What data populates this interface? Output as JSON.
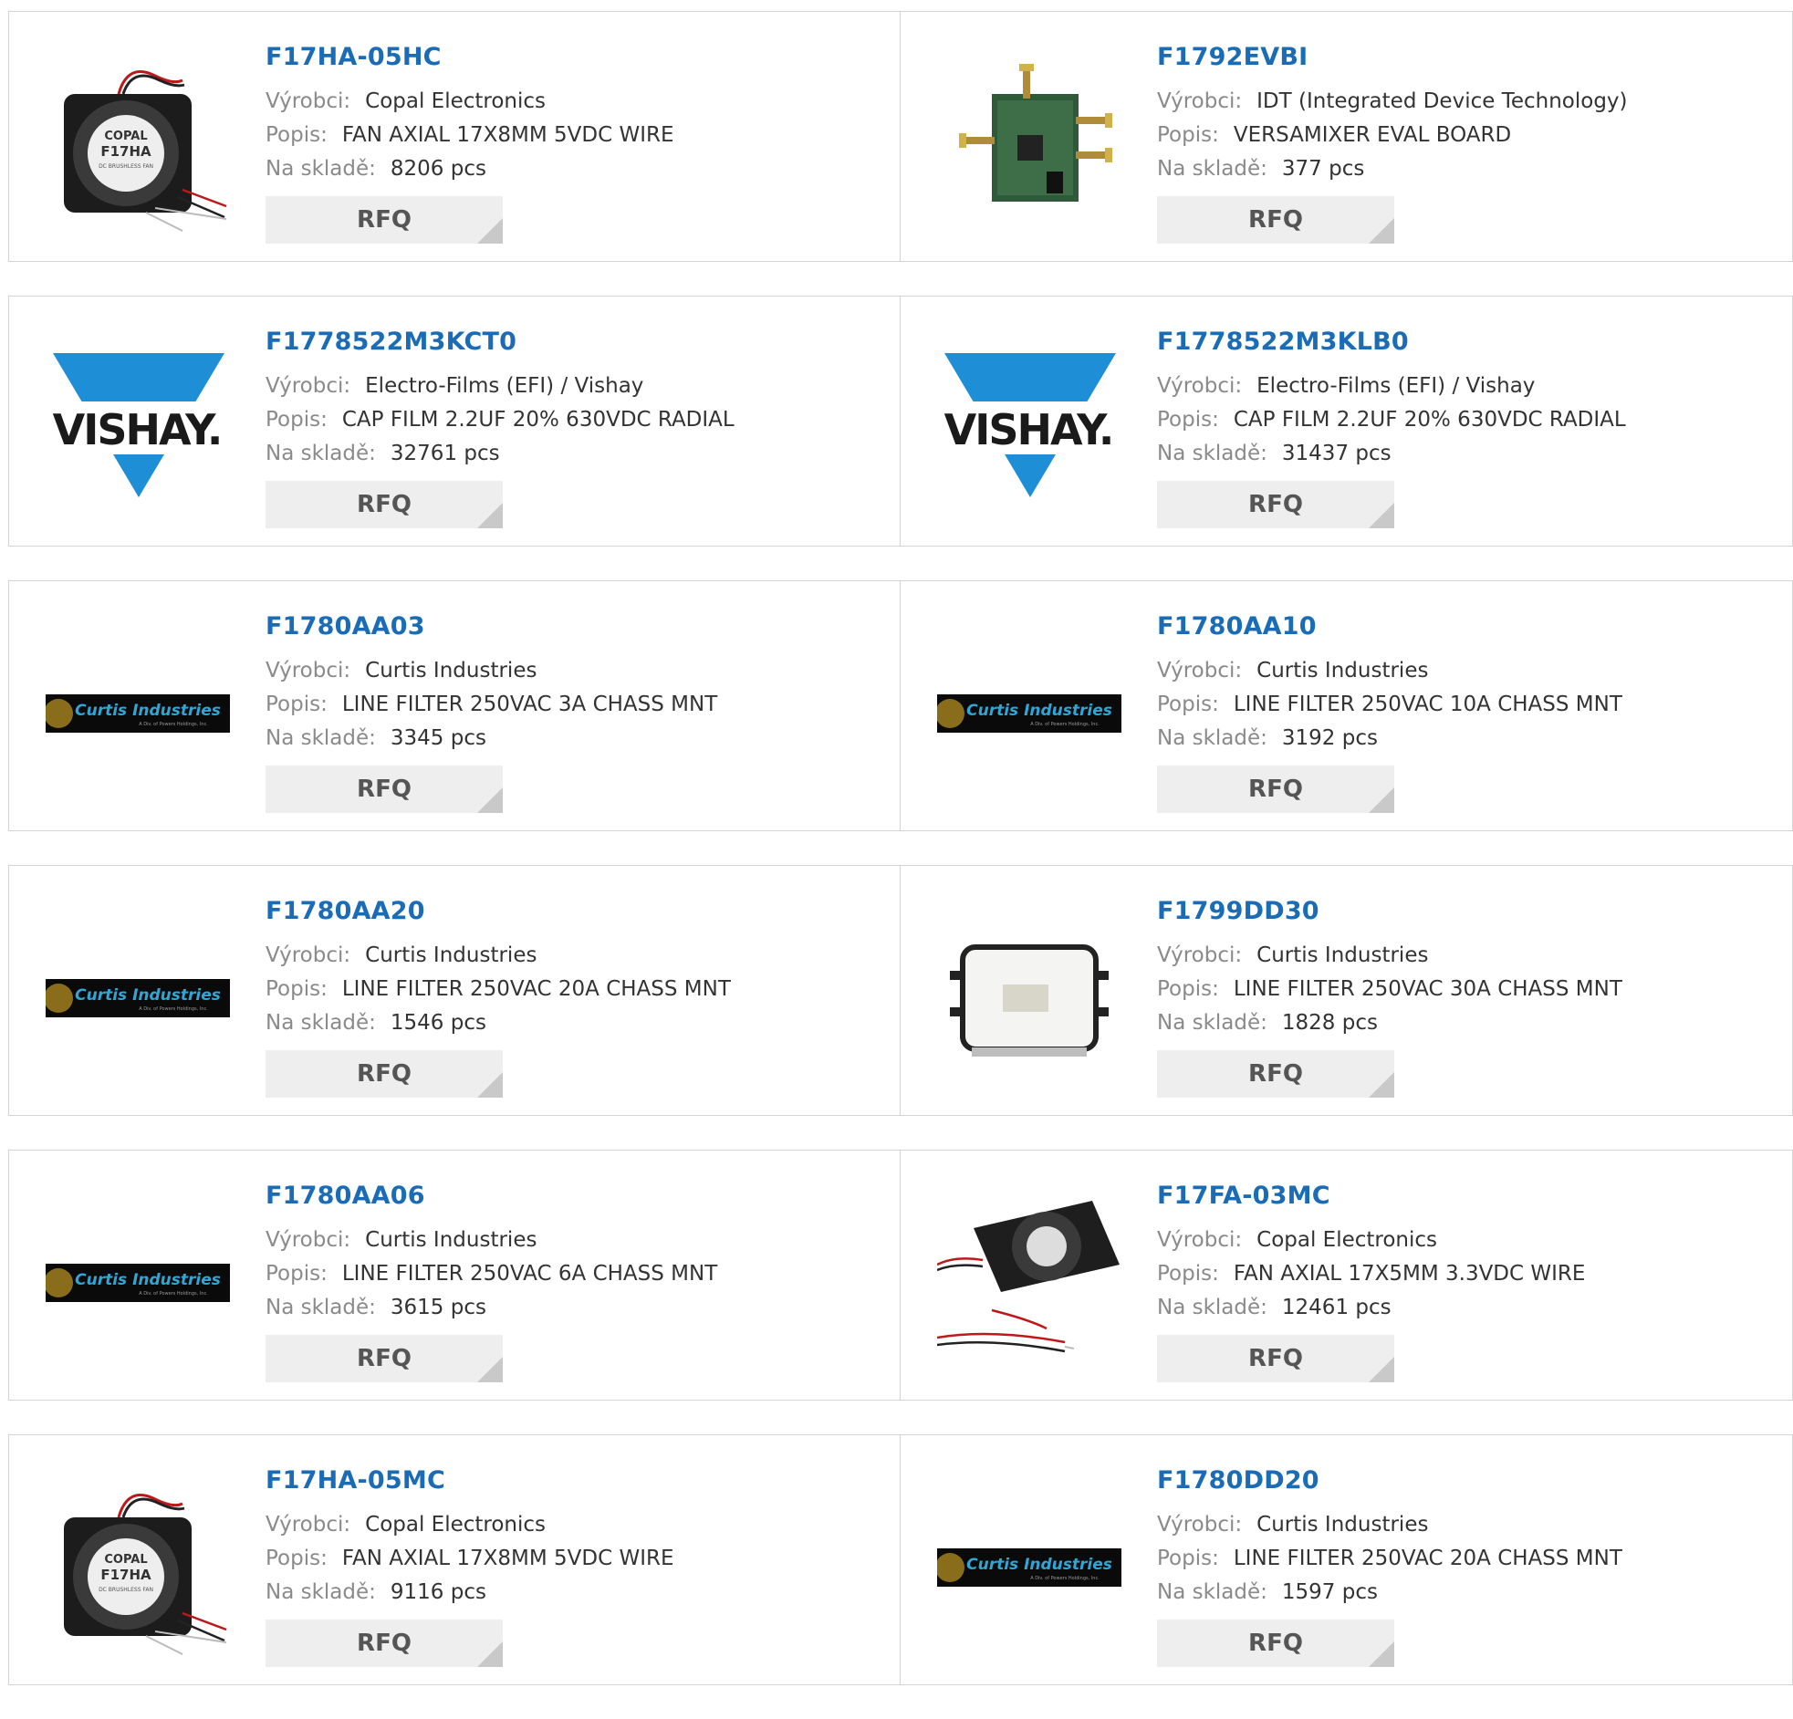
{
  "labels": {
    "manufacturer": "Výrobci:",
    "description": "Popis:",
    "stock": "Na skladě:",
    "rfq": "RFQ"
  },
  "colors": {
    "title_link": "#1a6cb6",
    "label_gray": "#8a8a8a",
    "rfq_bg": "#eeeeee",
    "vishay_blue": "#1e8fd6",
    "border": "#d3d3d3"
  },
  "products": [
    {
      "part": "F17HA-05HC",
      "manufacturer": "Copal Electronics",
      "description": "FAN AXIAL 17X8MM 5VDC WIRE",
      "stock": "8206 pcs",
      "image": "copal-fan-17ha",
      "fan_text": [
        "COPAL",
        "F17HA",
        "DC BRUSHLESS FAN"
      ]
    },
    {
      "part": "F1792EVBI",
      "manufacturer": "IDT (Integrated Device Technology)",
      "description": "VERSAMIXER EVAL BOARD",
      "stock": "377 pcs",
      "image": "eval-board"
    },
    {
      "part": "F1778522M3KCT0",
      "manufacturer": "Electro-Films (EFI) / Vishay",
      "description": "CAP FILM 2.2UF 20% 630VDC RADIAL",
      "stock": "32761 pcs",
      "image": "vishay-logo",
      "logo_text": "VISHAY."
    },
    {
      "part": "F1778522M3KLB0",
      "manufacturer": "Electro-Films (EFI) / Vishay",
      "description": "CAP FILM 2.2UF 20% 630VDC RADIAL",
      "stock": "31437 pcs",
      "image": "vishay-logo",
      "logo_text": "VISHAY."
    },
    {
      "part": "F1780AA03",
      "manufacturer": "Curtis Industries",
      "description": "LINE FILTER 250VAC 3A CHASS MNT",
      "stock": "3345 pcs",
      "image": "curtis-logo",
      "logo_text": "Curtis Industries",
      "logo_sub": "A Div. of Powers Holdings, Inc."
    },
    {
      "part": "F1780AA10",
      "manufacturer": "Curtis Industries",
      "description": "LINE FILTER 250VAC 10A CHASS MNT",
      "stock": "3192 pcs",
      "image": "curtis-logo",
      "logo_text": "Curtis Industries",
      "logo_sub": "A Div. of Powers Holdings, Inc."
    },
    {
      "part": "F1780AA20",
      "manufacturer": "Curtis Industries",
      "description": "LINE FILTER 250VAC 20A CHASS MNT",
      "stock": "1546 pcs",
      "image": "curtis-logo",
      "logo_text": "Curtis Industries",
      "logo_sub": "A Div. of Powers Holdings, Inc."
    },
    {
      "part": "F1799DD30",
      "manufacturer": "Curtis Industries",
      "description": "LINE FILTER 250VAC 30A CHASS MNT",
      "stock": "1828 pcs",
      "image": "line-filter-photo"
    },
    {
      "part": "F1780AA06",
      "manufacturer": "Curtis Industries",
      "description": "LINE FILTER 250VAC 6A CHASS MNT",
      "stock": "3615 pcs",
      "image": "curtis-logo",
      "logo_text": "Curtis Industries",
      "logo_sub": "A Div. of Powers Holdings, Inc."
    },
    {
      "part": "F17FA-03MC",
      "manufacturer": "Copal Electronics",
      "description": "FAN AXIAL 17X5MM 3.3VDC WIRE",
      "stock": "12461 pcs",
      "image": "copal-fan-17fa"
    },
    {
      "part": "F17HA-05MC",
      "manufacturer": "Copal Electronics",
      "description": "FAN AXIAL 17X8MM 5VDC WIRE",
      "stock": "9116 pcs",
      "image": "copal-fan-17ha",
      "fan_text": [
        "COPAL",
        "F17HA",
        "DC BRUSHLESS FAN"
      ]
    },
    {
      "part": "F1780DD20",
      "manufacturer": "Curtis Industries",
      "description": "LINE FILTER 250VAC 20A CHASS MNT",
      "stock": "1597 pcs",
      "image": "curtis-logo",
      "logo_text": "Curtis Industries",
      "logo_sub": "A Div. of Powers Holdings, Inc."
    }
  ]
}
